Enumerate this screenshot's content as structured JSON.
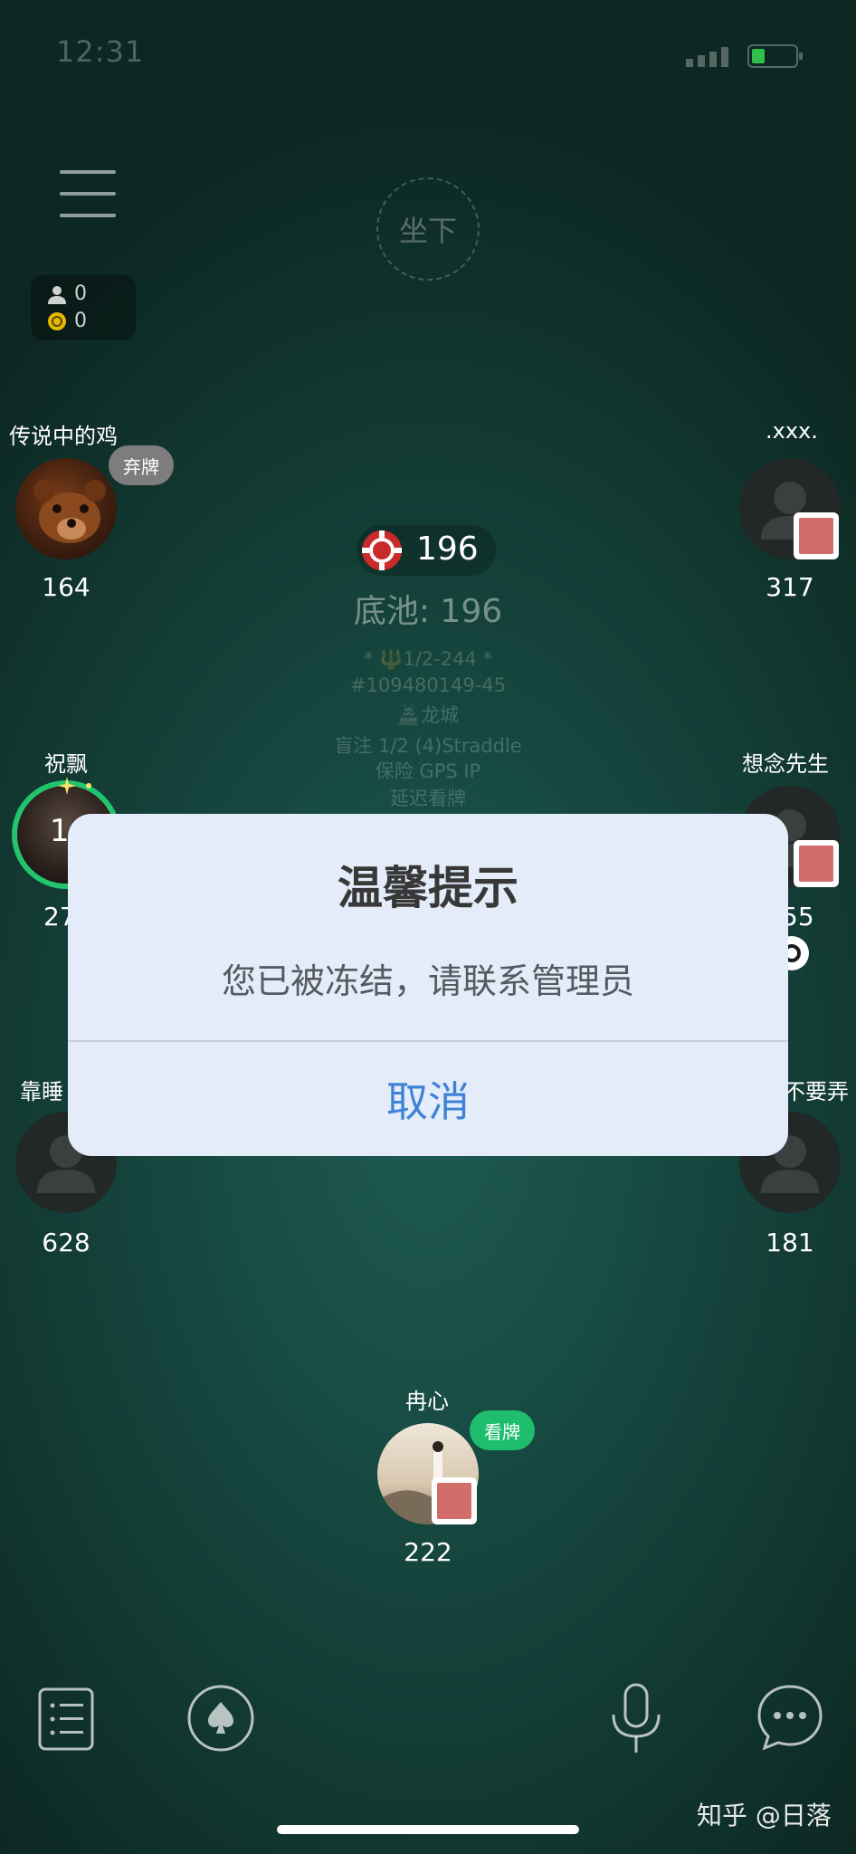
{
  "status_bar": {
    "time": "12:31"
  },
  "top": {
    "sit_label": "坐下",
    "stats": {
      "players": "0",
      "coins": "0"
    }
  },
  "players": {
    "top_left": {
      "name": "传说中的鸡",
      "score": "164",
      "badge": "弃牌"
    },
    "top_right": {
      "name": ".xxx.",
      "score": "317"
    },
    "mid_left": {
      "name": "祝飘",
      "score": "27",
      "timer": "1"
    },
    "mid_right": {
      "name": "想念先生",
      "score": "55"
    },
    "low_left": {
      "name": "靠睡",
      "score": "628"
    },
    "low_right": {
      "name": "不要弄",
      "score": "181"
    },
    "self": {
      "name": "冉心",
      "score": "222",
      "badge": "看牌"
    }
  },
  "pot": {
    "chips": "196",
    "total": "底池: 196"
  },
  "table_info": {
    "line1": "* 🔱1/2-244 *",
    "line2": "#109480149-45",
    "line3": "🏯龙城",
    "line4": "盲注 1/2 (4)Straddle",
    "line5": "保险 GPS IP",
    "line6": "延迟看牌"
  },
  "dialog": {
    "title": "温馨提示",
    "message": "您已被冻结，请联系管理员",
    "cancel": "取消"
  },
  "bottom_bar": {
    "icons": [
      "list-icon",
      "spade-icon",
      "microphone-icon",
      "chat-icon"
    ]
  },
  "watermark": "知乎 @日落",
  "colors": {
    "dialog_bg": "#e4ecf9",
    "cancel_blue": "#3e82d6",
    "check_green": "#1fbe6e",
    "fold_gray": "#7d7d7d",
    "card_red": "#d36d6a"
  }
}
